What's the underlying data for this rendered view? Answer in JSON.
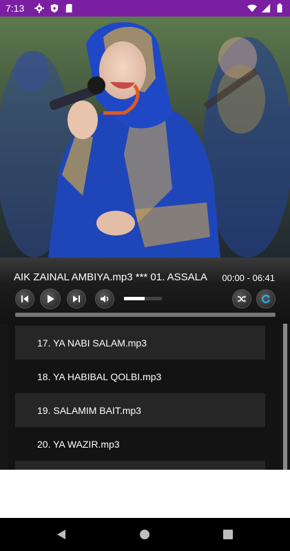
{
  "status_bar": {
    "time": "7:13",
    "left_icons": [
      "gear-icon",
      "shield-icon",
      "sd-card-icon"
    ],
    "right_icons": [
      "wifi-icon",
      "signal-icon",
      "battery-icon"
    ],
    "color": "#7b1fa2"
  },
  "hero": {
    "description_icon": "album-art"
  },
  "player": {
    "now_playing": "AIK ZAINAL AMBIYA.mp3 *** 01. ASSALA",
    "duration": "00:00 - 06:41",
    "volume": 0.55,
    "progress": 0.0,
    "controls": [
      "previous-icon",
      "play-icon",
      "next-icon",
      "volume-icon",
      "shuffle-icon",
      "repeat-icon"
    ],
    "accent": "#29b6f6"
  },
  "playlist": {
    "items": [
      "17. YA NABI SALAM.mp3",
      "18. YA HABIBAL QOLBI.mp3",
      "19. SALAMIM BAIT.mp3",
      "20. YA WAZIR.mp3",
      ""
    ]
  },
  "nav_bar": {
    "buttons": [
      "back-icon",
      "home-icon",
      "recents-icon"
    ]
  }
}
